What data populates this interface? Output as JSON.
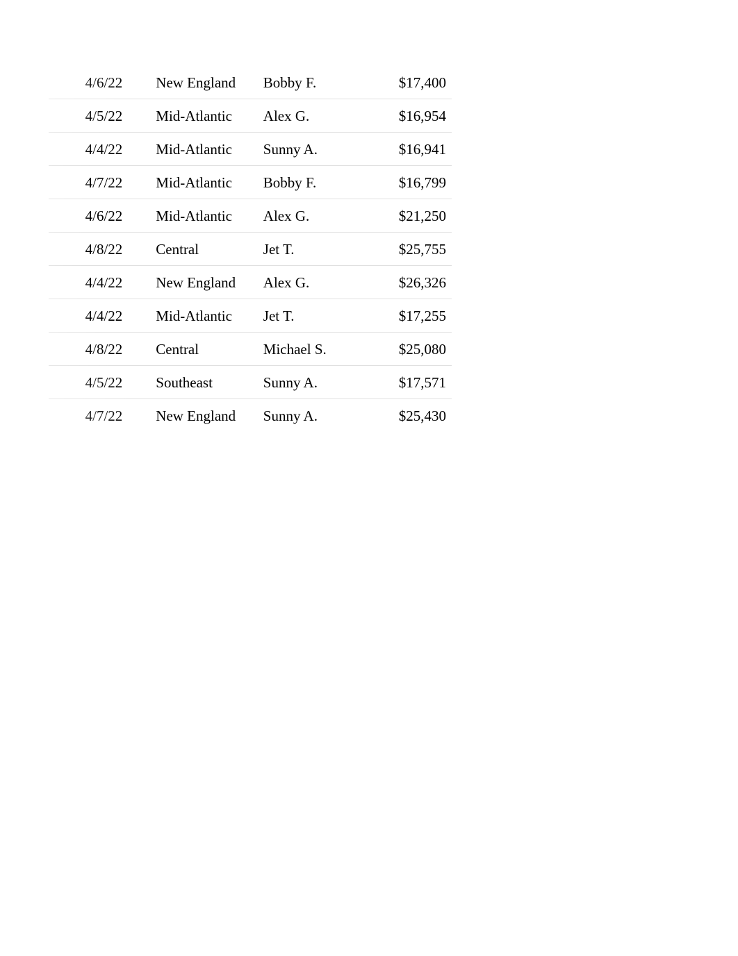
{
  "table": {
    "rows": [
      {
        "date": "4/6/22",
        "region": "New England",
        "person": "Bobby F.",
        "amount": "$17,400"
      },
      {
        "date": "4/5/22",
        "region": "Mid-Atlantic",
        "person": "Alex G.",
        "amount": "$16,954"
      },
      {
        "date": "4/4/22",
        "region": "Mid-Atlantic",
        "person": "Sunny A.",
        "amount": "$16,941"
      },
      {
        "date": "4/7/22",
        "region": "Mid-Atlantic",
        "person": "Bobby F.",
        "amount": "$16,799"
      },
      {
        "date": "4/6/22",
        "region": "Mid-Atlantic",
        "person": "Alex G.",
        "amount": "$21,250"
      },
      {
        "date": "4/8/22",
        "region": "Central",
        "person": "Jet T.",
        "amount": "$25,755"
      },
      {
        "date": "4/4/22",
        "region": "New England",
        "person": "Alex G.",
        "amount": "$26,326"
      },
      {
        "date": "4/4/22",
        "region": "Mid-Atlantic",
        "person": "Jet T.",
        "amount": "$17,255"
      },
      {
        "date": "4/8/22",
        "region": "Central",
        "person": "Michael S.",
        "amount": "$25,080"
      },
      {
        "date": "4/5/22",
        "region": "Southeast",
        "person": "Sunny A.",
        "amount": "$17,571"
      },
      {
        "date": "4/7/22",
        "region": "New England",
        "person": "Sunny A.",
        "amount": "$25,430"
      }
    ]
  }
}
